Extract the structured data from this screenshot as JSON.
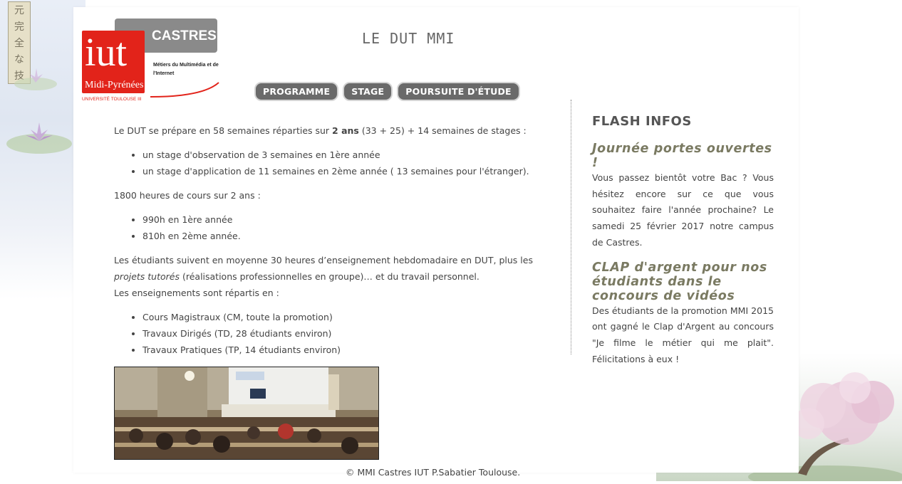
{
  "branding": {
    "logo_city": "CASTRES",
    "logo_iut": "iut",
    "logo_region": "Midi-Pyrénées",
    "logo_university": "UNIVERSITÉ TOULOUSE III",
    "logo_subtitle": "Métiers du Multimédia et de l'Internet",
    "seal_glyphs": [
      "元",
      "完",
      "全",
      "な",
      "技"
    ]
  },
  "header": {
    "title": "LE DUT MMI"
  },
  "nav": {
    "items": [
      {
        "label": "PROGRAMME"
      },
      {
        "label": "STAGE"
      },
      {
        "label": "POURSUITE D'ÉTUDE"
      }
    ]
  },
  "main": {
    "intro_before": "Le DUT se prépare en 58 semaines réparties sur ",
    "intro_bold": "2 ans",
    "intro_after": " (33 + 25) + 14 semaines de stages :",
    "stages": [
      "un stage d'observation de 3 semaines en 1ère année",
      "un stage d'application de 11 semaines en 2ème année ( 13 semaines pour l'étranger)."
    ],
    "hours": "1800 heures de cours sur 2 ans :",
    "hours_list": [
      "990h en 1ère année",
      "810h en 2ème année."
    ],
    "students_text_1": "Les étudiants suivent en moyenne 30 heures d’enseignement hebdomadaire en DUT, plus les ",
    "students_text_em": "projets tutorés",
    "students_text_2": " (réalisations professionnelles en groupe)… et du travail personnel.",
    "teaching_intro": "Les enseignements sont répartis en :",
    "teaching_list": [
      "Cours Magistraux (CM, toute la promotion)",
      "Travaux Dirigés (TD, 28 étudiants environ)",
      "Travaux Pratiques (TP, 14 étudiants environ)"
    ]
  },
  "sidebar": {
    "title": "FLASH INFOS",
    "news": [
      {
        "title": "Journée portes ouvertes !",
        "body": "Vous passez bientôt votre Bac ? Vous hésitez encore sur ce que vous souhaitez faire l'année prochaine? Le samedi 25 février 2017 notre campus de Castres."
      },
      {
        "title": "CLAP d'argent pour nos étudiants dans le concours de vidéos",
        "body": "Des étudiants de la promotion MMI 2015 ont gagné le Clap d'Argent au concours \"Je filme le métier qui me plait\". Félicitations à eux !"
      }
    ]
  },
  "footer": {
    "text": "© MMI Castres IUT P.Sabatier Toulouse."
  },
  "colors": {
    "accent": "#6a6a6a",
    "iut_red": "#e2231a",
    "news_title": "#7a7a62"
  }
}
